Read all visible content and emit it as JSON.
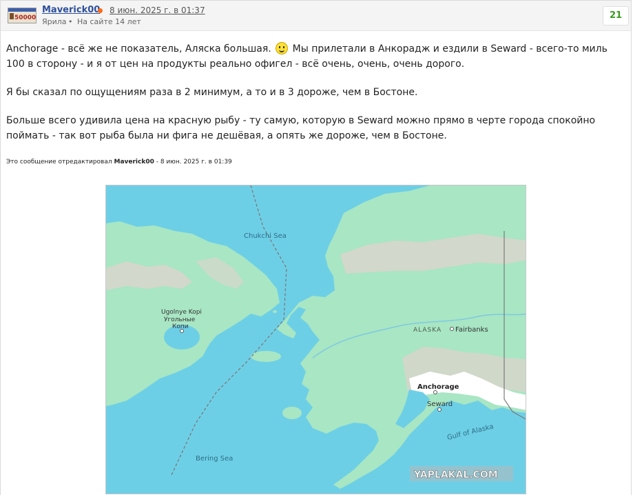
{
  "post": {
    "author": "Maverick00",
    "avatar_text": "50000",
    "date": "8 июн. 2025 г. в 01:37",
    "rank": "Ярила",
    "separator": "•",
    "online_since": "На сайте 14 лет",
    "rating": "21",
    "paragraphs": {
      "p1_before": "Anchorage - всё же не показатель, Аляска большая.",
      "p1_after": " Мы прилетали в Анкорадж и ездили в Seward - всего-то миль 100 в сторону - и я от цен на продукты реально офигел - всё очень, очень, очень дорого.",
      "p2": "Я бы сказал по ощущениям раза в 2 минимум, а то и в 3 дороже, чем в Бостоне.",
      "p3": "Больше всего удивила цена на красную рыбу - ту самую, которую в Seward можно прямо в черте города спокойно поймать - так вот рыба была ни фига не дешёвая, а опять же дороже, чем в Бостоне."
    },
    "edit_note": {
      "prefix": "Это сообщение отредактировал",
      "editor": "Maverick00",
      "suffix": "- 8 июн. 2025 г. в 01:39"
    }
  },
  "map": {
    "labels": {
      "chukchi_sea": "Chukchi Sea",
      "bering_sea": "Bering Sea",
      "gulf_of_alaska": "Gulf of Alaska",
      "alaska": "ALASKA",
      "fairbanks": "Fairbanks",
      "anchorage": "Anchorage",
      "seward": "Seward",
      "ugolnye_latin": "Ugolnye Kopi",
      "ugolnye_cyr_1": "Угольные",
      "ugolnye_cyr_2": "Копи"
    },
    "watermark": "YAPLAKAL.COM",
    "colors": {
      "water": "#6dcfe6",
      "land": "#a8e6c4",
      "mountain": "#d9d5cc",
      "snow": "#ffffff"
    }
  }
}
